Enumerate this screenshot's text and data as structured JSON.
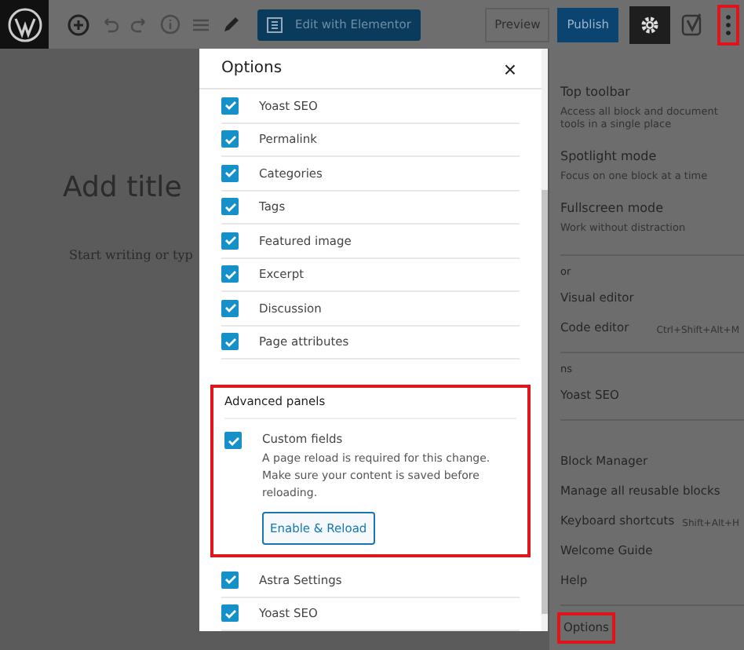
{
  "toolbar": {
    "elementor_button": "Edit with Elementor",
    "preview_button": "Preview",
    "publish_button": "Publish",
    "more_highlighted": true
  },
  "editor": {
    "title_placeholder": "Add title",
    "body_placeholder": "Start writing or typ"
  },
  "menu": {
    "items": [
      {
        "kind": "option",
        "label": "Top toolbar",
        "description": "Access all block and document tools in a single place"
      },
      {
        "kind": "option",
        "label": "Spotlight mode",
        "description": "Focus on one block at a time"
      },
      {
        "kind": "option",
        "label": "Fullscreen mode",
        "description": "Work without distraction"
      },
      {
        "kind": "divider"
      },
      {
        "kind": "heading",
        "label": "or"
      },
      {
        "kind": "item",
        "label": "Visual editor"
      },
      {
        "kind": "item",
        "label": "Code editor",
        "shortcut": "Ctrl+Shift+Alt+M"
      },
      {
        "kind": "divider"
      },
      {
        "kind": "heading",
        "label": "ns"
      },
      {
        "kind": "item",
        "label": "Yoast SEO"
      },
      {
        "kind": "divider"
      },
      {
        "kind": "spacer"
      },
      {
        "kind": "item",
        "label": "Block Manager"
      },
      {
        "kind": "item",
        "label": "Manage all reusable blocks"
      },
      {
        "kind": "item",
        "label": "Keyboard shortcuts",
        "shortcut": "Shift+Alt+H"
      },
      {
        "kind": "item",
        "label": "Welcome Guide"
      },
      {
        "kind": "item",
        "label": "Help"
      },
      {
        "kind": "divider"
      },
      {
        "kind": "item",
        "label": "Options",
        "highlighted": true
      }
    ]
  },
  "modal": {
    "title": "Options",
    "close": "×",
    "panels": [
      {
        "label": "Yoast SEO",
        "checked": true
      },
      {
        "label": "Permalink",
        "checked": true
      },
      {
        "label": "Categories",
        "checked": true
      },
      {
        "label": "Tags",
        "checked": true
      },
      {
        "label": "Featured image",
        "checked": true
      },
      {
        "label": "Excerpt",
        "checked": true
      },
      {
        "label": "Discussion",
        "checked": true
      },
      {
        "label": "Page attributes",
        "checked": true
      }
    ],
    "advanced": {
      "heading": "Advanced panels",
      "highlighted": true,
      "items": [
        {
          "label": "Custom fields",
          "checked": true,
          "notice": "A page reload is required for this change. Make sure your content is saved before reloading.",
          "button": "Enable & Reload"
        }
      ]
    },
    "more": [
      {
        "label": "Astra Settings",
        "checked": true
      },
      {
        "label": "Yoast SEO",
        "checked": true
      }
    ]
  }
}
